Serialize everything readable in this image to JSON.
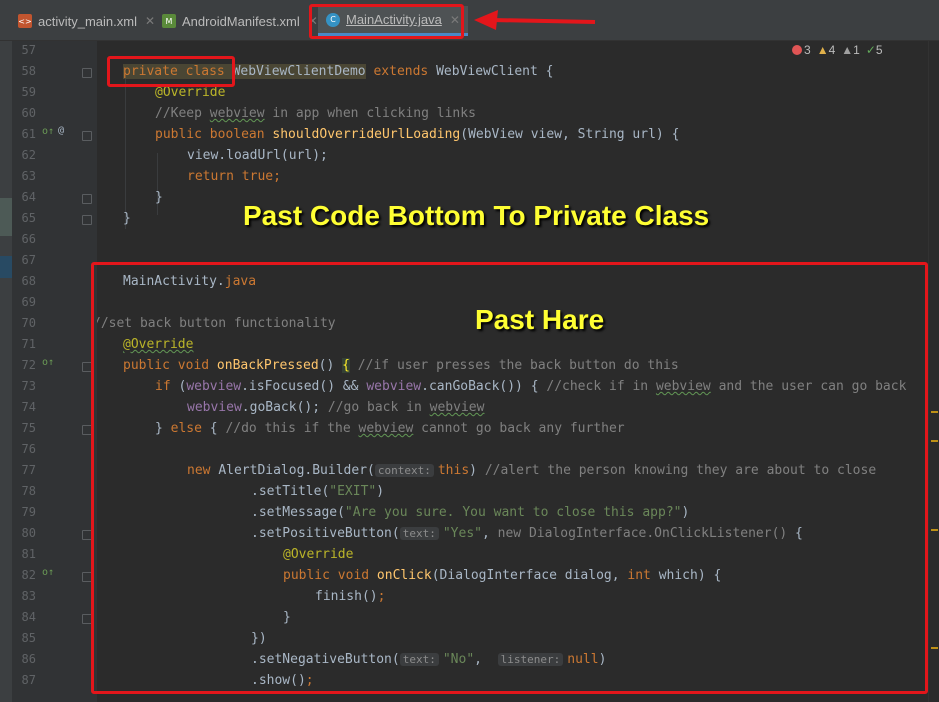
{
  "tabs": [
    {
      "label": "activity_main.xml",
      "icon": "xml-file-icon",
      "active": false
    },
    {
      "label": "AndroidManifest.xml",
      "icon": "manifest-file-icon",
      "active": false
    },
    {
      "label": "MainActivity.java",
      "icon": "java-class-icon",
      "active": true
    }
  ],
  "inspections": {
    "errors": "3",
    "warnings": "4",
    "weak_warnings": "1",
    "typos": "5"
  },
  "line_numbers": [
    "57",
    "58",
    "59",
    "60",
    "61",
    "62",
    "63",
    "64",
    "65",
    "66",
    "67",
    "68",
    "69",
    "70",
    "71",
    "72",
    "73",
    "74",
    "75",
    "76",
    "77",
    "78",
    "79",
    "80",
    "81",
    "82",
    "83",
    "84",
    "85",
    "86",
    "87"
  ],
  "code": {
    "l58_private_class": "private class",
    "l58_name": "WebViewClientDemo",
    "l58_extends": " extends ",
    "l58_base": "WebViewClient {",
    "l59": "@Override",
    "l60_a": "//Keep ",
    "l60_b": "webview",
    "l60_c": " in app when clicking links",
    "l61_a": "public boolean ",
    "l61_b": "shouldOverrideUrlLoading",
    "l61_c": "(WebView view, String url) {",
    "l62": "view.loadUrl(url);",
    "l63": "return true;",
    "l64": "}",
    "l65": "}",
    "l68_a": "MainActivity.",
    "l68_b": "java",
    "l70": "//set back button functionality",
    "l71": "@Override",
    "l72_a": "public void ",
    "l72_b": "onBackPressed",
    "l72_c": "() ",
    "l72_d": "{",
    "l72_e": " //if user presses the back button do this",
    "l73_a": "if ",
    "l73_b": "(",
    "l73_c": "webview",
    "l73_d": ".isFocused() && ",
    "l73_e": "webview",
    "l73_f": ".canGoBack()) { ",
    "l73_g": "//check if in ",
    "l73_h": "webview",
    "l73_i": " and the user can go back",
    "l74_a": "webview",
    "l74_b": ".goBack(); ",
    "l74_c": "//go back in ",
    "l74_d": "webview",
    "l75_a": "} ",
    "l75_b": "else",
    "l75_c": " { ",
    "l75_d": "//do this if the ",
    "l75_e": "webview",
    "l75_f": " cannot go back any further",
    "l77_a": "new ",
    "l77_b": "AlertDialog.Builder(",
    "l77_hint": "context:",
    "l77_c": "this",
    "l77_d": ") ",
    "l77_e": "//alert the person knowing they are about to close",
    "l78_a": ".setTitle(",
    "l78_b": "\"EXIT\"",
    "l78_c": ")",
    "l79_a": ".setMessage(",
    "l79_b": "\"Are you sure. You want to close this app?\"",
    "l79_c": ")",
    "l80_a": ".setPositiveButton(",
    "l80_hint": "text:",
    "l80_b": "\"Yes\"",
    "l80_c": ", ",
    "l80_d": "new DialogInterface.OnClickListener()",
    "l80_e": " {",
    "l81": "@Override",
    "l82_a": "public void ",
    "l82_b": "onClick",
    "l82_c": "(DialogInterface dialog, ",
    "l82_d": "int",
    "l82_e": " which) {",
    "l83_a": "finish()",
    "l83_b": ";",
    "l84": "}",
    "l85": "})",
    "l86_a": ".setNegativeButton(",
    "l86_hint1": "text:",
    "l86_b": "\"No\"",
    "l86_c": ",  ",
    "l86_hint2": "listener:",
    "l86_d": "null",
    "l86_e": ")",
    "l87_a": ".show()",
    "l87_b": ";"
  },
  "annotations": {
    "heading1": "Past Code Bottom To Private Class",
    "heading2": "Past Hare"
  },
  "colors": {
    "highlight_red": "#e3161b",
    "annotation_yellow": "#ffff33",
    "editor_bg": "#2b2b2b"
  }
}
